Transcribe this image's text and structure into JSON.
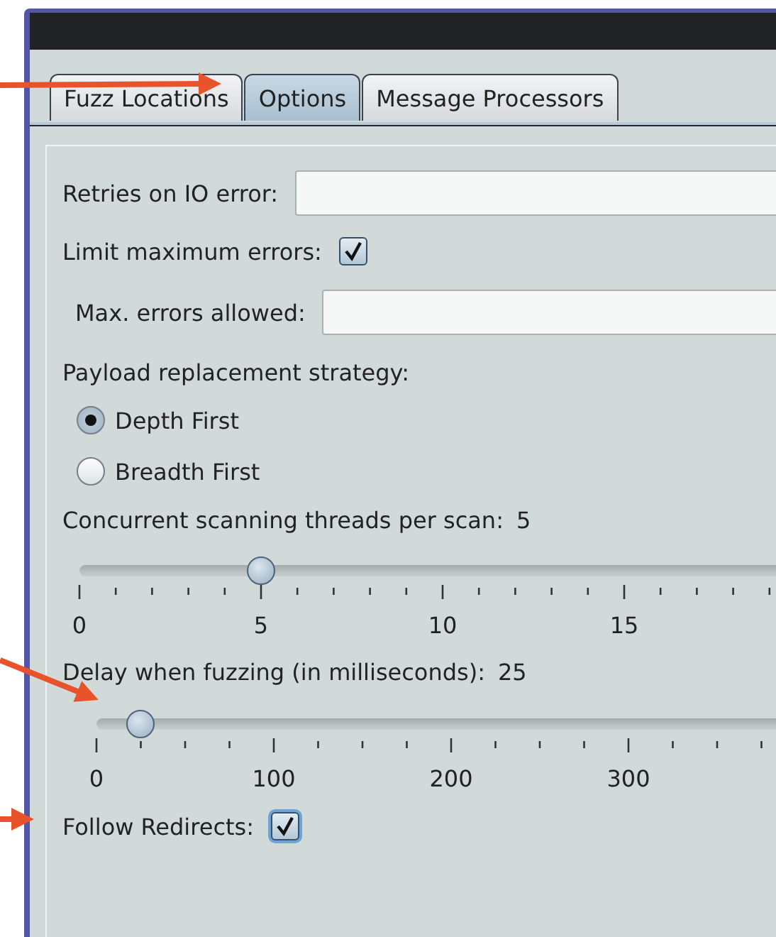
{
  "tabs": [
    {
      "label": "Fuzz Locations",
      "selected": false
    },
    {
      "label": "Options",
      "selected": true
    },
    {
      "label": "Message Processors",
      "selected": false
    }
  ],
  "options": [
    {
      "kind": "field",
      "label": "Retries on IO error:",
      "indented": false
    },
    {
      "kind": "checkbox",
      "label": "Limit maximum errors:",
      "checked": true,
      "focused": false
    },
    {
      "kind": "field",
      "label": "Max. errors allowed:",
      "indented": true
    },
    {
      "kind": "heading",
      "label": "Payload replacement strategy:"
    },
    {
      "kind": "radio",
      "label": "Depth First",
      "selected": true
    },
    {
      "kind": "radio",
      "label": "Breadth First",
      "selected": false
    },
    {
      "kind": "heading",
      "label": "Concurrent scanning threads per scan:",
      "value": "5"
    },
    {
      "kind": "slider",
      "level": 0.25,
      "labels": [
        "0",
        "5",
        "10",
        "15"
      ]
    },
    {
      "kind": "heading",
      "label": "Delay when fuzzing (in milliseconds):",
      "value": "25"
    },
    {
      "kind": "slider",
      "level": 0.0625,
      "labels": [
        "0",
        "100",
        "200",
        "300"
      ]
    },
    {
      "kind": "checkbox",
      "label": "Follow Redirects:",
      "checked": true,
      "focused": true
    }
  ]
}
